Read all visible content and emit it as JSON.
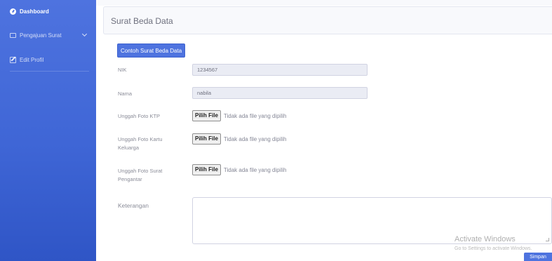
{
  "sidebar": {
    "items": [
      {
        "label": "Dashboard",
        "icon": "tachometer-icon"
      },
      {
        "label": "Pengajuan Surat",
        "icon": "folder-icon"
      },
      {
        "label": "Edit Profil",
        "icon": "edit-icon"
      }
    ]
  },
  "card": {
    "title": "Surat Beda Data"
  },
  "form": {
    "example_button": "Contoh Surat Beda Data",
    "nik": {
      "label": "NIK",
      "value": "1234567"
    },
    "nama": {
      "label": "Nama",
      "value": "nabila"
    },
    "ktp": {
      "label": "Unggah Foto KTP",
      "button": "Pilih File",
      "status": "Tidak ada file yang dipilih"
    },
    "kk": {
      "label": "Unggah Foto Kartu Keluarga",
      "button": "Pilih File",
      "status": "Tidak ada file yang dipilih"
    },
    "pengantar": {
      "label": "Unggah Foto Surat Pengantar",
      "button": "Pilih File",
      "status": "Tidak ada file yang dipilih"
    },
    "keterangan": {
      "label": "Keterangan",
      "value": ""
    },
    "save_button": "Simpan"
  },
  "watermark": {
    "line1": "Activate Windows",
    "line2": "Go to Settings to activate Windows."
  },
  "colors": {
    "primary": "#4e73df",
    "sidebar_bottom": "#2f55c6"
  }
}
